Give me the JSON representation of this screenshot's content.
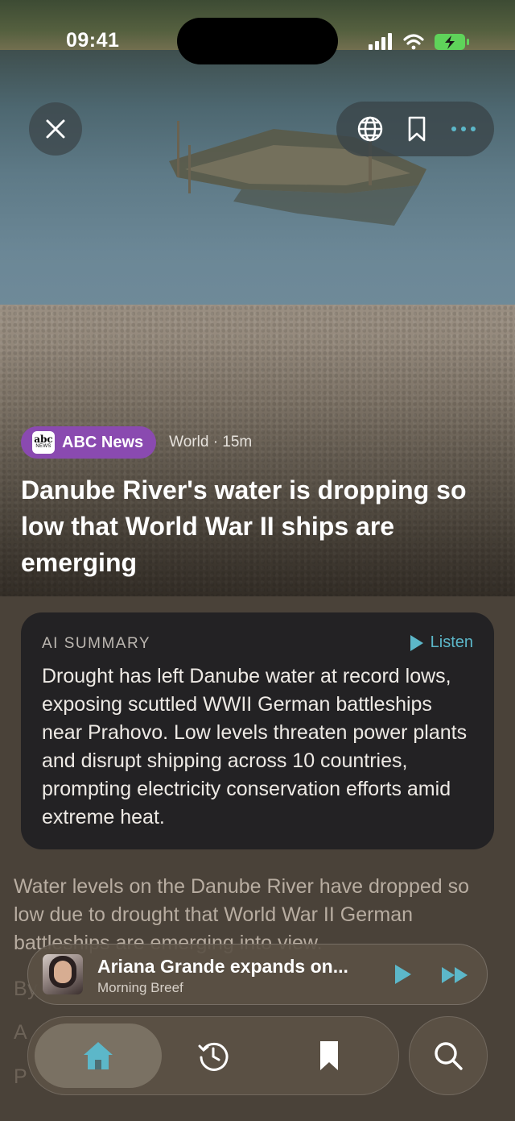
{
  "status_bar": {
    "time": "09:41"
  },
  "toolbar": {
    "close_icon": "close-icon",
    "globe_icon": "globe-icon",
    "bookmark_icon": "bookmark-icon",
    "more_icon": "more-icon"
  },
  "article": {
    "source": "ABC News",
    "source_logo_top": "abc",
    "source_logo_bottom": "NEWS",
    "section": "World · 15m",
    "headline": "Danube River's water is dropping so low that World War II ships are emerging",
    "body": "Water levels on the Danube River have dropped so low due to drought that World War II German battleships are emerging into view."
  },
  "summary": {
    "label": "AI SUMMARY",
    "listen_label": "Listen",
    "text": "Drought has left Danube water at record lows, exposing scuttled WWII German battleships near Prahovo. Low levels threaten power plants and disrupt shipping across 10 countries, prompting electricity conservation efforts amid extreme heat."
  },
  "player": {
    "title": "Ariana Grande expands on...",
    "subtitle": "Morning Breef"
  },
  "tabs": [
    {
      "name": "home",
      "icon": "home-icon",
      "active": true
    },
    {
      "name": "history",
      "icon": "history-icon",
      "active": false
    },
    {
      "name": "saved",
      "icon": "bookmark-icon",
      "active": false
    }
  ],
  "search_icon": "search-icon",
  "colors": {
    "accent": "#5cb7c9",
    "source_badge": "#8a4ab0",
    "summary_bg": "#232224",
    "background": "#4a4239"
  }
}
